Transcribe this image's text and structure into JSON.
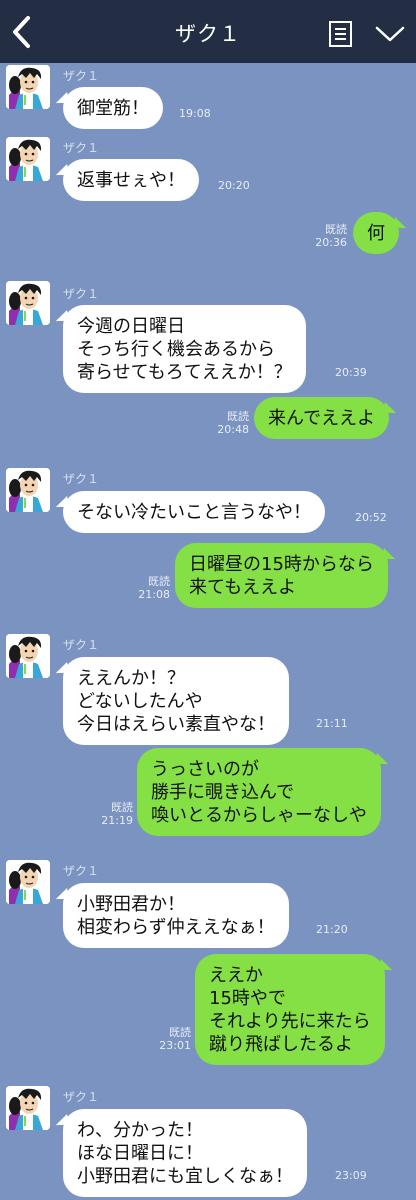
{
  "header": {
    "title": "ザク１",
    "back_icon": "chevron-left-icon",
    "note_icon": "note-list-icon",
    "menu_icon": "chevron-down-icon"
  },
  "colors": {
    "header_bg": "#232e45",
    "chat_bg": "#7b93c1",
    "incoming_bubble": "#ffffff",
    "outgoing_bubble": "#84e045"
  },
  "messages": [
    {
      "direction": "in",
      "sender": "ザク１",
      "text": "御堂筋！",
      "time": "19:08"
    },
    {
      "direction": "in",
      "sender": "ザク１",
      "text": "返事せぇや！",
      "time": "20:20"
    },
    {
      "direction": "out",
      "read": "既読",
      "text": "何",
      "time": "20:36"
    },
    {
      "direction": "in",
      "sender": "ザク１",
      "text": "今週の日曜日\nそっち行く機会あるから\n寄らせてもろてええか！？",
      "time": "20:39"
    },
    {
      "direction": "out",
      "read": "既読",
      "text": "来んでええよ",
      "time": "20:48"
    },
    {
      "direction": "in",
      "sender": "ザク１",
      "text": "そない冷たいこと言うなや！",
      "time": "20:52"
    },
    {
      "direction": "out",
      "read": "既読",
      "text": "日曜昼の15時からなら\n来てもええよ",
      "time": "21:08"
    },
    {
      "direction": "in",
      "sender": "ザク１",
      "text": "ええんか！？\nどないしたんや\n今日はえらい素直やな！",
      "time": "21:11"
    },
    {
      "direction": "out",
      "read": "既読",
      "text": "うっさいのが\n勝手に覗き込んで\n喚いとるからしゃーなしや",
      "time": "21:19"
    },
    {
      "direction": "in",
      "sender": "ザク１",
      "text": "小野田君か！\n相変わらず仲ええなぁ！",
      "time": "21:20"
    },
    {
      "direction": "out",
      "read": "既読",
      "text": "ええか\n15時やで\nそれより先に来たら\n蹴り飛ばしたるよ",
      "time": "23:01"
    },
    {
      "direction": "in",
      "sender": "ザク１",
      "text": "わ、分かった！\nほな日曜日に！\n小野田君にも宜しくなぁ！",
      "time": "23:09"
    }
  ]
}
